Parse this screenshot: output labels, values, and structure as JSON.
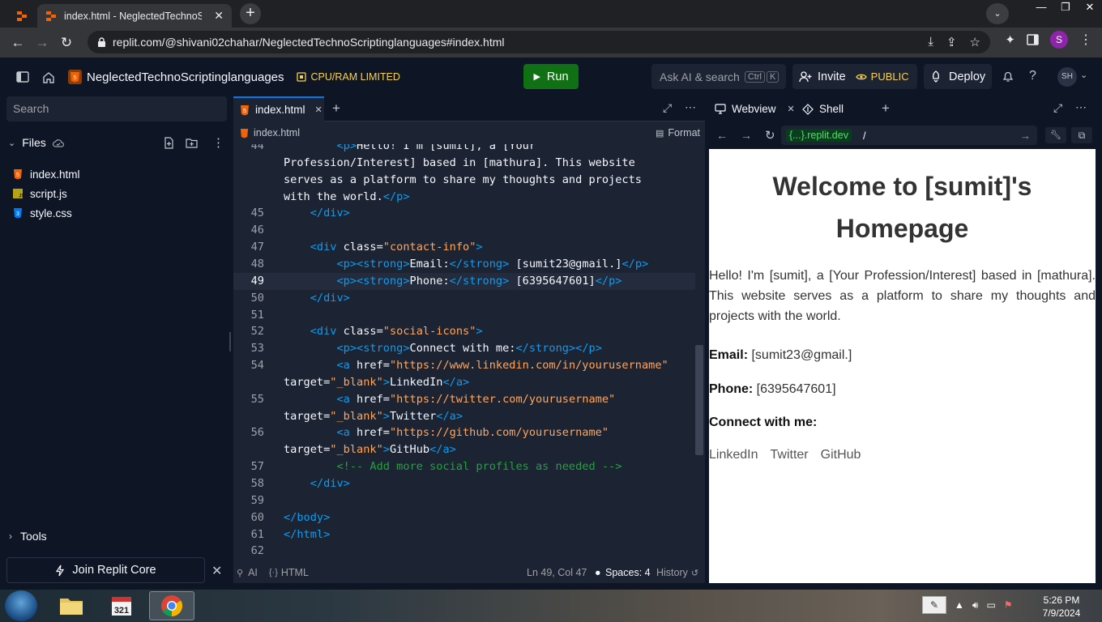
{
  "browser": {
    "tab_title": "index.html - NeglectedTechnoScr",
    "tab_close": "✕",
    "new_tab": "+",
    "url": "replit.com/@shivani02chahar/NeglectedTechnoScriptinglanguages#index.html",
    "profile_initial": "S",
    "window_controls": [
      "—",
      "❐",
      "✕"
    ]
  },
  "replit_header": {
    "repl_name": "NeglectedTechnoScriptinglanguages",
    "cpu_label": "CPU/RAM LIMITED",
    "run_label": "Run",
    "search_label": "Ask AI & search",
    "kbd_ctrl": "Ctrl",
    "kbd_k": "K",
    "invite_label": "Invite",
    "public_label": "PUBLIC",
    "deploy_label": "Deploy",
    "user_initials": "SH"
  },
  "sidebar": {
    "search_placeholder": "Search",
    "files_label": "Files",
    "files": [
      {
        "name": "index.html",
        "icon": "html5-icon"
      },
      {
        "name": "script.js",
        "icon": "js-icon"
      },
      {
        "name": "style.css",
        "icon": "css3-icon"
      }
    ],
    "tools_label": "Tools",
    "join_label": "Join Replit Core"
  },
  "editor": {
    "tab_name": "index.html",
    "breadcrumb": "index.html",
    "format_label": "Format",
    "lines": [
      {
        "n": "44",
        "text": "        <p>Hello! I'm [sumit], a [Your"
      },
      {
        "n": "",
        "text": "Profession/Interest] based in [mathura]. This website"
      },
      {
        "n": "",
        "text": "serves as a platform to share my thoughts and projects"
      },
      {
        "n": "",
        "text": "with the world.</p>"
      },
      {
        "n": "45",
        "text": "    </div>"
      },
      {
        "n": "46",
        "text": ""
      },
      {
        "n": "47",
        "text": "    <div class=\"contact-info\">"
      },
      {
        "n": "48",
        "text": "        <p><strong>Email:</strong> [sumit23@gmail.]</p>"
      },
      {
        "n": "49",
        "text": "        <p><strong>Phone:</strong> [6395647601]</p>"
      },
      {
        "n": "50",
        "text": "    </div>"
      },
      {
        "n": "51",
        "text": ""
      },
      {
        "n": "52",
        "text": "    <div class=\"social-icons\">"
      },
      {
        "n": "53",
        "text": "        <p><strong>Connect with me:</strong></p>"
      },
      {
        "n": "54",
        "text": "        <a href=\"https://www.linkedin.com/in/yourusername\""
      },
      {
        "n": "",
        "text": "target=\"_blank\">LinkedIn</a>"
      },
      {
        "n": "55",
        "text": "        <a href=\"https://twitter.com/yourusername\""
      },
      {
        "n": "",
        "text": "target=\"_blank\">Twitter</a>"
      },
      {
        "n": "56",
        "text": "        <a href=\"https://github.com/yourusername\""
      },
      {
        "n": "",
        "text": "target=\"_blank\">GitHub</a>"
      },
      {
        "n": "57",
        "text": "        <!-- Add more social profiles as needed -->"
      },
      {
        "n": "58",
        "text": "    </div>"
      },
      {
        "n": "59",
        "text": ""
      },
      {
        "n": "60",
        "text": "</body>"
      },
      {
        "n": "61",
        "text": "</html>"
      },
      {
        "n": "62",
        "text": ""
      }
    ],
    "current_line": "49",
    "status_ai": "AI",
    "status_lang": "HTML",
    "status_pos": "Ln 49, Col 47",
    "status_spaces": "Spaces: 4",
    "status_history": "History"
  },
  "right_pane": {
    "tab_webview": "Webview",
    "tab_shell": "Shell",
    "url_domain": "{...}.replit.dev",
    "url_path": "/"
  },
  "webview": {
    "title": "Welcome to [sumit]'s Homepage",
    "intro": "Hello! I'm [sumit], a [Your Profession/Interest] based in [mathura]. This website serves as a platform to share my thoughts and projects with the world.",
    "email_label": "Email:",
    "email_value": "[sumit23@gmail.]",
    "phone_label": "Phone:",
    "phone_value": "[6395647601]",
    "connect_label": "Connect with me:",
    "links": [
      "LinkedIn",
      "Twitter",
      "GitHub"
    ]
  },
  "taskbar": {
    "time": "5:26 PM",
    "date": "7/9/2024"
  },
  "colors": {
    "replit_bg": "#0e1525",
    "editor_bg": "#1c2333",
    "run_green": "#0f7014",
    "accent_blue": "#0079f2",
    "tag_blue": "#0c9df0",
    "string_orange": "#ffa75e",
    "comment_green": "#21a33d"
  }
}
